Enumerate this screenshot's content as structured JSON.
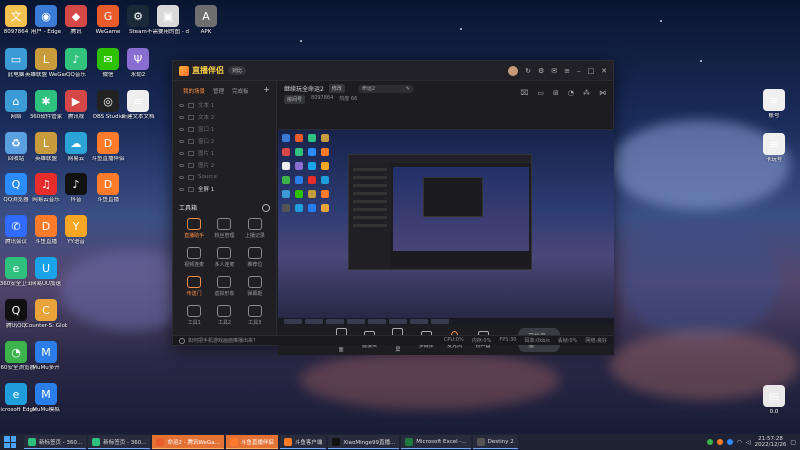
{
  "desktop": {
    "left_icons": [
      {
        "label": "8097864",
        "color": "#f2c14e",
        "glyph": "文"
      },
      {
        "label": "用户 -\nEdge",
        "color": "#3a7bd5",
        "glyph": "◉"
      },
      {
        "label": "腾讯",
        "color": "#d64848",
        "glyph": "◆"
      },
      {
        "label": "WeGame",
        "color": "#e85b2b",
        "glyph": "G"
      },
      {
        "label": "Steam",
        "color": "#1b2838",
        "glyph": "⚙"
      },
      {
        "label": "不需要用的图 - ddh-tf-3_d...",
        "color": "#d9d9d9",
        "glyph": "▣"
      },
      {
        "label": "APK",
        "color": "#6e6e6e",
        "glyph": "A"
      },
      {
        "label": "此电脑",
        "color": "#3a9bd5",
        "glyph": "▭"
      },
      {
        "label": "英雄联盟\nWeGame版",
        "color": "#c89b3c",
        "glyph": "L"
      },
      {
        "label": "QQ音乐",
        "color": "#31c27c",
        "glyph": "♪"
      },
      {
        "label": "微信",
        "color": "#2dc100",
        "glyph": "✉"
      },
      {
        "label": "永劫2",
        "color": "#8a6dd1",
        "glyph": "Ψ"
      },
      {
        "label": "网络",
        "color": "#3a9bd5",
        "glyph": "⌂"
      },
      {
        "label": "360软件管家",
        "color": "#2ec27e",
        "glyph": "✱"
      },
      {
        "label": "腾讯视",
        "color": "#d64848",
        "glyph": "▶"
      },
      {
        "label": "OBS Studio",
        "color": "#222",
        "glyph": "◎"
      },
      {
        "label": "新建文本文档",
        "color": "#eee",
        "glyph": "≡"
      },
      {
        "label": "回收站",
        "color": "#5aa0e0",
        "glyph": "♻"
      },
      {
        "label": "英雄联盟",
        "color": "#c89b3c",
        "glyph": "L"
      },
      {
        "label": "网易云",
        "color": "#2ba3d6",
        "glyph": "☁"
      },
      {
        "label": "斗鱼直播伴侣",
        "color": "#ff7b2c",
        "glyph": "D"
      },
      {
        "label": "QQ浏览器",
        "color": "#2b8cff",
        "glyph": "Q"
      },
      {
        "label": "网易云音乐",
        "color": "#e72d2c",
        "glyph": "♫"
      },
      {
        "label": "抖音",
        "color": "#111",
        "glyph": "♪"
      },
      {
        "label": "斗鱼直播",
        "color": "#ff7b2c",
        "glyph": "D"
      },
      {
        "label": "腾讯会议",
        "color": "#2f6bff",
        "glyph": "✆"
      },
      {
        "label": "斗鱼直播",
        "color": "#ff7b2c",
        "glyph": "D"
      },
      {
        "label": "YY语音",
        "color": "#f5a623",
        "glyph": "Y"
      },
      {
        "label": "360安全卫士",
        "color": "#2ec27e",
        "glyph": "e"
      },
      {
        "label": "网易UU加速",
        "color": "#1aa3e8",
        "glyph": "U"
      },
      {
        "label": "腾讯QQ",
        "color": "#111",
        "glyph": "Q"
      },
      {
        "label": "Counter-S: Global Off...",
        "color": "#e8a33a",
        "glyph": "C"
      },
      {
        "label": "360安全浏览器",
        "color": "#3cb44b",
        "glyph": "◔"
      },
      {
        "label": "MuMu多开",
        "color": "#2b7de9",
        "glyph": "M"
      },
      {
        "label": "Microsoft Edge",
        "color": "#1f9edb",
        "glyph": "e"
      },
      {
        "label": "MuMu模拟",
        "color": "#2b7de9",
        "glyph": "M"
      }
    ],
    "right_icons": [
      {
        "label": "账号",
        "color": "#f0f0f0",
        "glyph": "≡"
      },
      {
        "label": "卡玩号",
        "color": "#f0f0f0",
        "glyph": "≡"
      },
      {
        "label": "0.0",
        "color": "#e9e9e9",
        "glyph": "▤"
      }
    ]
  },
  "app": {
    "title": "直播伴侣",
    "title_badge": "对比",
    "sidebar": {
      "tabs": [
        "我的场景",
        "管理",
        "完成板"
      ],
      "sources": [
        "文本 1",
        "文本 2",
        "窗口 1",
        "窗口 2",
        "图片 1",
        "图片 2",
        "Source",
        "全屏 1"
      ],
      "tools_title": "工具箱",
      "tools": [
        "直播助手",
        "粉丝管理",
        "上播记录",
        "视频连麦",
        "多人连麦",
        "推荐位",
        "传送门",
        "虚拟形象",
        "弹幕姬",
        "工具1",
        "工具2",
        "工具3"
      ]
    },
    "main": {
      "room_title": "继续玩全命运2",
      "room_tag": "修改",
      "category": "命运2",
      "sub": [
        "房间号",
        "8097864",
        "热度 66"
      ],
      "controls": [
        "直播画面",
        "摄像头",
        "手机投屏",
        "多媒体",
        "麦克风",
        "扬声器"
      ],
      "start_label": "开始直播"
    },
    "status": {
      "help": "如何把手机游戏画面推播出来？",
      "stats": [
        "CPU:0%",
        "内存:0%",
        "FPS:30",
        "码率:0kb/s",
        "丢帧:0%",
        "网络:良好"
      ]
    }
  },
  "taskbar": {
    "tasks": [
      {
        "label": "新标签页 - 360...",
        "color": "#2ec27e",
        "active": false
      },
      {
        "label": "新标签页 - 360...",
        "color": "#2ec27e",
        "active": false
      },
      {
        "label": "命运2 - 腾讯WeGa...",
        "color": "#e85b2b",
        "active": true
      },
      {
        "label": "斗鱼直播伴侣",
        "color": "#ff7b2c",
        "active": true
      },
      {
        "label": "斗鱼客户端",
        "color": "#ff7b2c",
        "active": false
      },
      {
        "label": "XiaoMinge99直播...",
        "color": "#111",
        "active": false
      },
      {
        "label": "Microsoft Excel -...",
        "color": "#1f7a3e",
        "active": false
      },
      {
        "label": "Destiny 2",
        "color": "#555",
        "active": false
      }
    ],
    "time": "21:57:28",
    "date": "2022/12/26"
  }
}
